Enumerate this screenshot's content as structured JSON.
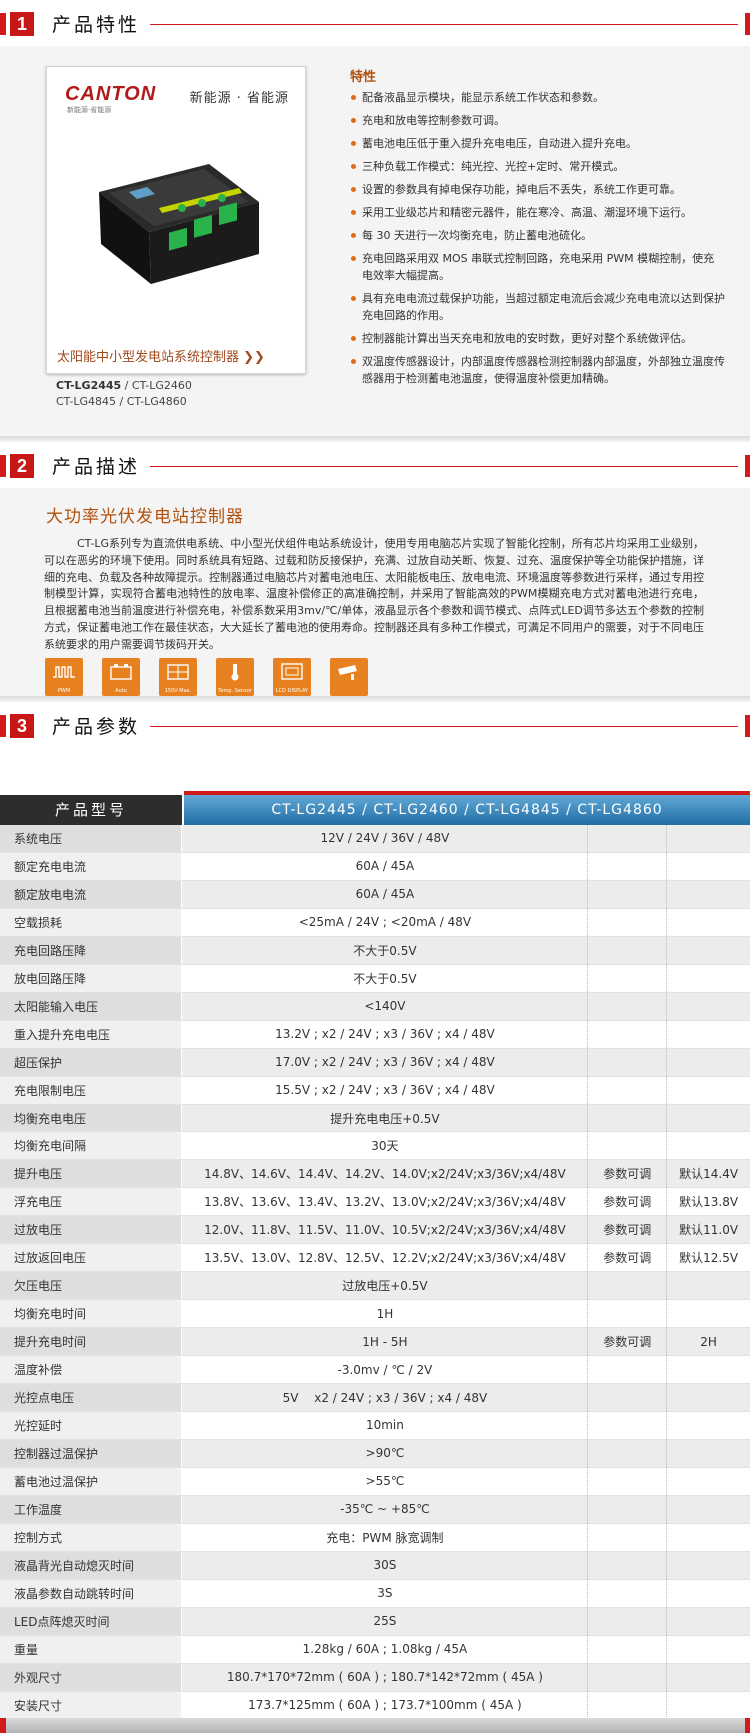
{
  "sections": {
    "features": {
      "number": "1",
      "title": "产品特性"
    },
    "description": {
      "number": "2",
      "title": "产品描述"
    },
    "params": {
      "number": "3",
      "title": "产品参数"
    }
  },
  "product_card": {
    "logo": "CANTON",
    "logo_sub": "新能源·省能源",
    "slogan": "新能源 · 省能源",
    "caption": "太阳能中小型发电站系统控制器 ❯❯",
    "models_line1_bold": "CT-LG2445",
    "models_line1_rest": " / CT-LG2460",
    "models_line2": "CT-LG4845 / CT-LG4860"
  },
  "features": {
    "heading": "特性",
    "items": [
      "配备液晶显示模块，能显示系统工作状态和参数。",
      "充电和放电等控制参数可调。",
      "蓄电池电压低于重入提升充电电压，自动进入提升充电。",
      "三种负载工作模式：纯光控、光控+定时、常开模式。",
      "设置的参数具有掉电保存功能，掉电后不丢失，系统工作更可靠。",
      "采用工业级芯片和精密元器件，能在寒冷、高温、潮湿环境下运行。",
      "每 30 天进行一次均衡充电，防止蓄电池硫化。",
      "充电回路采用双 MOS 串联式控制回路，充电采用 PWM 模糊控制，使充电效率大幅提高。",
      "具有充电电流过载保护功能，当超过额定电流后会减少充电电流以达到保护充电回路的作用。",
      "控制器能计算出当天充电和放电的安时数，更好对整个系统做评估。",
      "双温度传感器设计，内部温度传感器检测控制器内部温度，外部独立温度传感器用于检测蓄电池温度，使得温度补偿更加精确。"
    ]
  },
  "description": {
    "subtitle": "大功率光伏发电站控制器",
    "text": "CT-LG系列专为直流供电系统、中小型光伏组件电站系统设计，使用专用电脑芯片实现了智能化控制，所有芯片均采用工业级别，可以在恶劣的环境下使用。同时系统具有短路、过载和防反接保护，充满、过放自动关断、恢复、过充、温度保护等全功能保护措施，详细的充电、负载及各种故障提示。控制器通过电脑芯片对蓄电池电压、太阳能板电压、放电电流、环境温度等参数进行采样，通过专用控制模型计算，实现符合蓄电池特性的放电率、温度补偿修正的高准确控制，并采用了智能高效的PWM模糊充电方式对蓄电池进行充电，且根据蓄电池当前温度进行补偿充电，补偿系数采用3mv/℃/单体，液晶显示各个参数和调节模式、点阵式LED调节多达五个参数的控制方式，保证蓄电池工作在最佳状态，大大延长了蓄电池的使用寿命。控制器还具有多种工作模式，可满足不同用户的需要，对于不同电压系统要求的用户需要调节拨码开关。",
    "icons": [
      {
        "name": "pwm-icon",
        "caption": "PWM"
      },
      {
        "name": "battery-auto-icon",
        "caption": "Auto"
      },
      {
        "name": "solar-panel-icon",
        "caption": "150V Max."
      },
      {
        "name": "temperature-icon",
        "caption": "Temp. Sensor"
      },
      {
        "name": "lcd-display-icon",
        "caption": "LCD DISPLAY"
      },
      {
        "name": "camera-icon",
        "caption": ""
      }
    ]
  },
  "params": {
    "header_name": "产品型号",
    "header_value": "CT-LG2445 / CT-LG2460 / CT-LG4845 / CT-LG4860",
    "rows": [
      {
        "name": "系统电压",
        "value": "12V / 24V / 36V / 48V",
        "adj": "",
        "def": ""
      },
      {
        "name": "额定充电电流",
        "value": "60A / 45A",
        "adj": "",
        "def": ""
      },
      {
        "name": "额定放电电流",
        "value": "60A / 45A",
        "adj": "",
        "def": ""
      },
      {
        "name": "空载损耗",
        "value": "<25mA / 24V ; <20mA / 48V",
        "adj": "",
        "def": ""
      },
      {
        "name": "充电回路压降",
        "value": "不大于0.5V",
        "adj": "",
        "def": ""
      },
      {
        "name": "放电回路压降",
        "value": "不大于0.5V",
        "adj": "",
        "def": ""
      },
      {
        "name": "太阳能输入电压",
        "value": "<140V",
        "adj": "",
        "def": ""
      },
      {
        "name": "重入提升充电电压",
        "value": "13.2V ; x2 / 24V ; x3 / 36V ; x4 / 48V",
        "adj": "",
        "def": ""
      },
      {
        "name": "超压保护",
        "value": "17.0V ; x2 / 24V ; x3 / 36V ; x4 / 48V",
        "adj": "",
        "def": ""
      },
      {
        "name": "充电限制电压",
        "value": "15.5V ; x2 / 24V ; x3 / 36V ; x4 / 48V",
        "adj": "",
        "def": ""
      },
      {
        "name": "均衡充电电压",
        "value": "提升充电电压+0.5V",
        "adj": "",
        "def": ""
      },
      {
        "name": "均衡充电间隔",
        "value": "30天",
        "adj": "",
        "def": ""
      },
      {
        "name": "提升电压",
        "value": "14.8V、14.6V、14.4V、14.2V、14.0V;x2/24V;x3/36V;x4/48V",
        "adj": "参数可调",
        "def": "默认14.4V"
      },
      {
        "name": "浮充电压",
        "value": "13.8V、13.6V、13.4V、13.2V、13.0V;x2/24V;x3/36V;x4/48V",
        "adj": "参数可调",
        "def": "默认13.8V"
      },
      {
        "name": "过放电压",
        "value": "12.0V、11.8V、11.5V、11.0V、10.5V;x2/24V;x3/36V;x4/48V",
        "adj": "参数可调",
        "def": "默认11.0V"
      },
      {
        "name": "过放返回电压",
        "value": "13.5V、13.0V、12.8V、12.5V、12.2V;x2/24V;x3/36V;x4/48V",
        "adj": "参数可调",
        "def": "默认12.5V"
      },
      {
        "name": "欠压电压",
        "value": "过放电压+0.5V",
        "adj": "",
        "def": ""
      },
      {
        "name": "均衡充电时间",
        "value": "1H",
        "adj": "",
        "def": ""
      },
      {
        "name": "提升充电时间",
        "value": "1H - 5H",
        "adj": "参数可调",
        "def": "2H"
      },
      {
        "name": "温度补偿",
        "value": "-3.0mv / ℃ / 2V",
        "adj": "",
        "def": ""
      },
      {
        "name": "光控点电压",
        "value": "5V　 x2 / 24V ; x3 / 36V ; x4 / 48V",
        "adj": "",
        "def": ""
      },
      {
        "name": "光控延时",
        "value": "10min",
        "adj": "",
        "def": ""
      },
      {
        "name": "控制器过温保护",
        "value": ">90℃",
        "adj": "",
        "def": ""
      },
      {
        "name": "蓄电池过温保护",
        "value": ">55℃",
        "adj": "",
        "def": ""
      },
      {
        "name": "工作温度",
        "value": "-35℃ ~ +85℃",
        "adj": "",
        "def": ""
      },
      {
        "name": "控制方式",
        "value": "充电：PWM 脉宽调制",
        "adj": "",
        "def": ""
      },
      {
        "name": "液晶背光自动熄灭时间",
        "value": "30S",
        "adj": "",
        "def": ""
      },
      {
        "name": "液晶参数自动跳转时间",
        "value": "3S",
        "adj": "",
        "def": ""
      },
      {
        "name": "LED点阵熄灭时间",
        "value": "25S",
        "adj": "",
        "def": ""
      },
      {
        "name": "重量",
        "value": "1.28kg / 60A ; 1.08kg / 45A",
        "adj": "",
        "def": ""
      },
      {
        "name": "外观尺寸",
        "value": "180.7*170*72mm ( 60A ) ; 180.7*142*72mm ( 45A )",
        "adj": "",
        "def": ""
      },
      {
        "name": "安装尺寸",
        "value": "173.7*125mm ( 60A ) ; 173.7*100mm ( 45A )",
        "adj": "",
        "def": ""
      }
    ]
  }
}
